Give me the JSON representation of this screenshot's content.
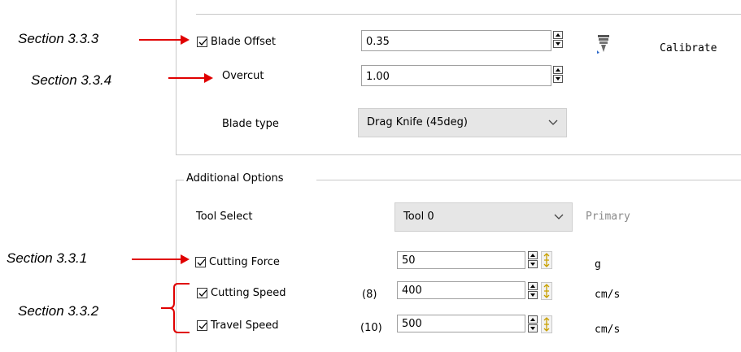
{
  "annotations": {
    "blade_offset": "Section 3.3.3",
    "overcut": "Section 3.3.4",
    "cutting_force": "Section 3.3.1",
    "speeds": "Section 3.3.2"
  },
  "blade": {
    "blade_offset": {
      "label": "Blade Offset",
      "value": "0.35",
      "checked": true
    },
    "overcut": {
      "label": "Overcut",
      "value": "1.00"
    },
    "calibrate_label": "Calibrate",
    "blade_type": {
      "label": "Blade type",
      "value": "Drag Knife (45deg)"
    }
  },
  "additional": {
    "title": "Additional Options",
    "tool_select": {
      "label": "Tool Select",
      "value": "Tool 0",
      "note": "Primary"
    },
    "cutting_force": {
      "label": "Cutting Force",
      "value": "50",
      "unit": "g",
      "checked": true
    },
    "cutting_speed": {
      "label": "Cutting Speed",
      "index": "(8)",
      "value": "400",
      "unit": "cm/s",
      "checked": true
    },
    "travel_speed": {
      "label": "Travel Speed",
      "index": "(10)",
      "value": "500",
      "unit": "cm/s",
      "checked": true
    }
  },
  "colors": {
    "arrow": "#e00000",
    "dropdown_bg": "#e6e6e6"
  },
  "icons": [
    "checkbox-check-icon",
    "spin-up-icon",
    "spin-down-icon",
    "chevron-down-icon",
    "knife-calibrate-icon",
    "adjust-handle-icon"
  ]
}
